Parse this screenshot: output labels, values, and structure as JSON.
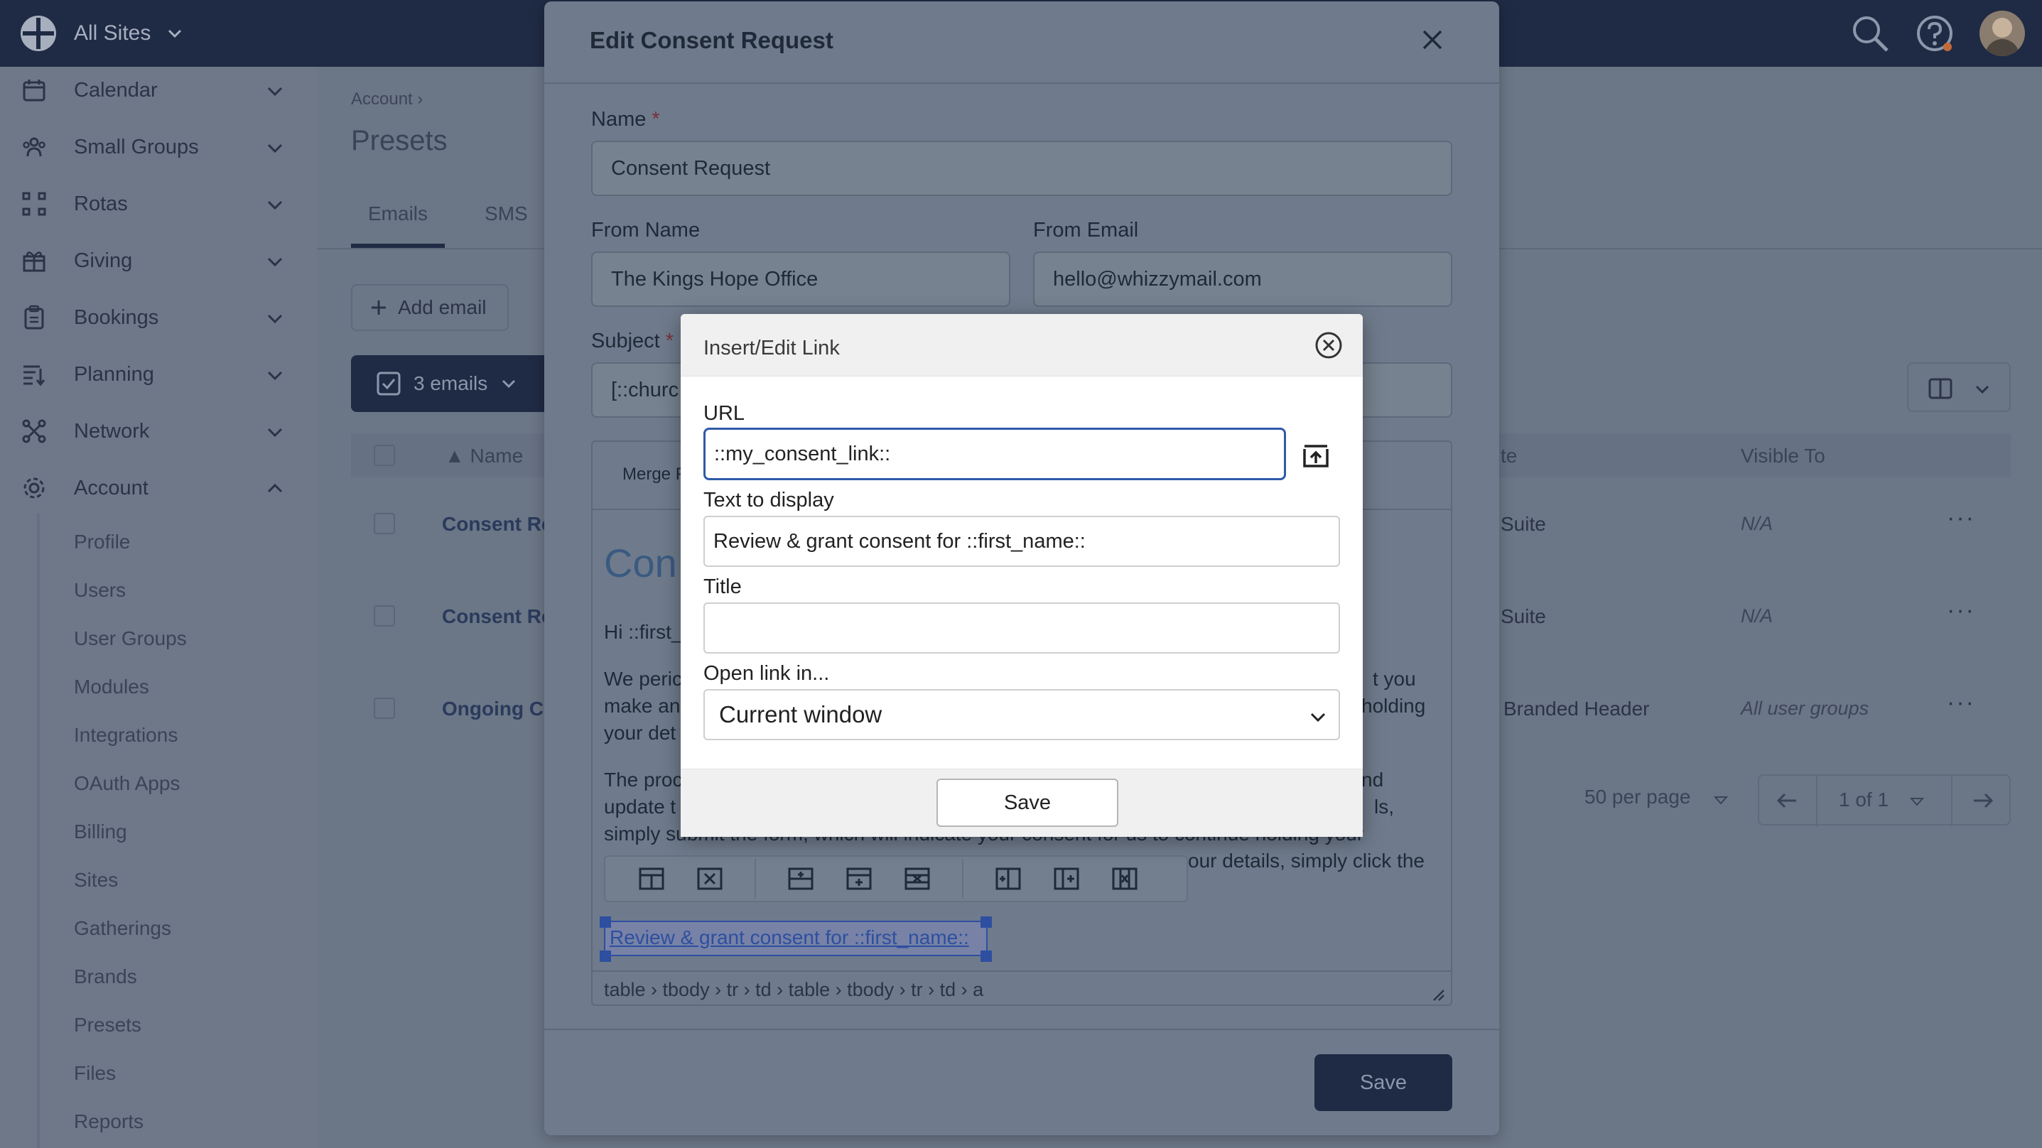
{
  "topbar": {
    "site_label": "All Sites"
  },
  "sidebar": {
    "items": [
      {
        "label": "Calendar",
        "icon": "calendar-icon"
      },
      {
        "label": "Small Groups",
        "icon": "people-icon"
      },
      {
        "label": "Rotas",
        "icon": "rota-icon"
      },
      {
        "label": "Giving",
        "icon": "gift-icon"
      },
      {
        "label": "Bookings",
        "icon": "clipboard-icon"
      },
      {
        "label": "Planning",
        "icon": "planning-icon"
      },
      {
        "label": "Network",
        "icon": "network-icon"
      },
      {
        "label": "Account",
        "icon": "gear-icon"
      }
    ],
    "account_sub": [
      "Profile",
      "Users",
      "User Groups",
      "Modules",
      "Integrations",
      "OAuth Apps",
      "Billing",
      "Sites",
      "Gatherings",
      "Brands",
      "Presets",
      "Files",
      "Reports"
    ]
  },
  "page": {
    "breadcrumb": "Account",
    "title": "Presets",
    "tabs": [
      "Emails",
      "SMS"
    ],
    "add_email": "Add email",
    "selection": "3 emails",
    "columns": {
      "name": "Name",
      "template": "te",
      "visible_to": "Visible To"
    },
    "rows": [
      {
        "name": "Consent Re",
        "brand": "Suite",
        "visible": "N/A"
      },
      {
        "name": "Consent Re",
        "brand": "Suite",
        "visible": "N/A"
      },
      {
        "name": "Ongoing Co",
        "brand": "Branded Header",
        "visible": "All user groups"
      }
    ],
    "per_page": "50 per page",
    "page_indicator": "1 of 1"
  },
  "modal": {
    "title": "Edit Consent Request",
    "name_label": "Name",
    "name_value": "Consent Request",
    "from_name_label": "From Name",
    "from_name_value": "The Kings Hope Office",
    "from_email_label": "From Email",
    "from_email_value": "hello@whizzymail.com",
    "subject_label": "Subject",
    "subject_value": "[::churc",
    "required_mark": "*",
    "merge_label": "Merge F",
    "editor": {
      "heading": "Con",
      "greeting": "Hi ::first_",
      "p1_l1a": "We peric",
      "p1_l1b": "t you",
      "p1_l2a": "make an",
      "p1_l2b": "holding",
      "p1_l3": "your det",
      "p2_l1a": "The proc",
      "p2_l1b": "nd",
      "p2_l2a": "update t",
      "p2_l2b": "ls,",
      "p2_l3": "simply submit the form, which will indicate your consent for us to continue holding your",
      "p2_l4": "our details, simply click the",
      "link_text": "Review & grant consent for ::first_name::",
      "status_path": "table › tbody › tr › td › table › tbody › tr › td › a"
    },
    "save": "Save"
  },
  "link_dialog": {
    "title": "Insert/Edit Link",
    "url_label": "URL",
    "url_value": "::my_consent_link::",
    "text_label": "Text to display",
    "text_value": "Review & grant consent for ::first_name::",
    "title_label": "Title",
    "title_value": "",
    "open_label": "Open link in...",
    "open_value": "Current window",
    "save": "Save"
  },
  "colors": {
    "navy": "#1f2a44",
    "focus_blue": "#2f5aa8",
    "link_blue": "#2e4fa0",
    "required": "#7a2f39"
  }
}
